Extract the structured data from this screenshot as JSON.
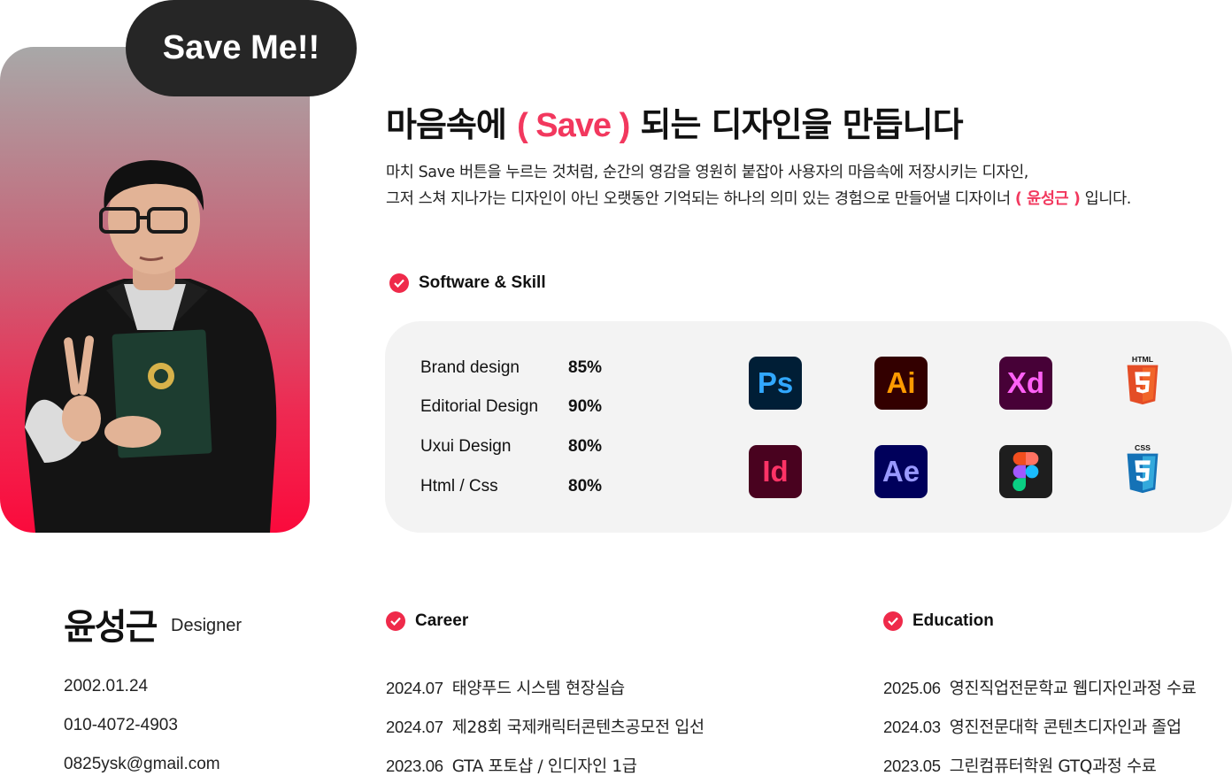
{
  "hero": {
    "badge": "Save Me!!",
    "headline_before": "마음속에 ",
    "headline_accent": "( Save )",
    "headline_after": " 되는 디자인을 만듭니다",
    "intro_line1": "마치 Save 버튼을 누르는 것처럼, 순간의 영감을 영원히 붙잡아 사용자의 마음속에 저장시키는 디자인,",
    "intro_line2_before": "그저 스쳐 지나가는 디자인이 아닌 오랫동안 기억되는 하나의 의미 있는 경험으로 만들어낼 디자이너 ",
    "intro_line2_accent": "( 윤성근 )",
    "intro_line2_after": " 입니다."
  },
  "skills": {
    "title": "Software & Skill",
    "items": [
      {
        "name": "Brand design",
        "percent": "85%"
      },
      {
        "name": "Editorial Design",
        "percent": "90%"
      },
      {
        "name": "Uxui Design",
        "percent": "80%"
      },
      {
        "name": "Html / Css",
        "percent": "80%"
      }
    ],
    "icons": [
      {
        "label": "Ps",
        "name": "photoshop-icon",
        "bg": "#001e36",
        "fg": "#31a8ff"
      },
      {
        "label": "Ai",
        "name": "illustrator-icon",
        "bg": "#330000",
        "fg": "#ff9a00"
      },
      {
        "label": "Xd",
        "name": "xd-icon",
        "bg": "#470137",
        "fg": "#ff61f6"
      },
      {
        "label": "Id",
        "name": "indesign-icon",
        "bg": "#49021f",
        "fg": "#ff3366"
      },
      {
        "label": "Ae",
        "name": "after-effects-icon",
        "bg": "#00005b",
        "fg": "#9999ff"
      }
    ],
    "html_label": "HTML",
    "css_label": "CSS"
  },
  "profile": {
    "name": "윤성근",
    "role": "Designer",
    "birth": "2002.01.24",
    "phone": "010-4072-4903",
    "email": "0825ysk@gmail.com"
  },
  "career": {
    "title": "Career",
    "items": [
      {
        "date": "2024.07",
        "text": "태양푸드 시스템 현장실습"
      },
      {
        "date": "2024.07",
        "text": "제28회 국제캐릭터콘텐츠공모전 입선"
      },
      {
        "date": "2023.06",
        "text": "GTA 포토샵 / 인디자인 1급"
      }
    ]
  },
  "education": {
    "title": "Education",
    "items": [
      {
        "date": "2025.06",
        "text": "영진직업전문학교 웹디자인과정 수료"
      },
      {
        "date": "2024.03",
        "text": "영진전문대학 콘텐츠디자인과 졸업"
      },
      {
        "date": "2023.05",
        "text": "그린컴퓨터학원 GTQ과정 수료"
      }
    ]
  },
  "colors": {
    "accent": "#f2385e",
    "check": "#ef2a4a",
    "panel": "#f3f3f3",
    "badge": "#262626"
  }
}
